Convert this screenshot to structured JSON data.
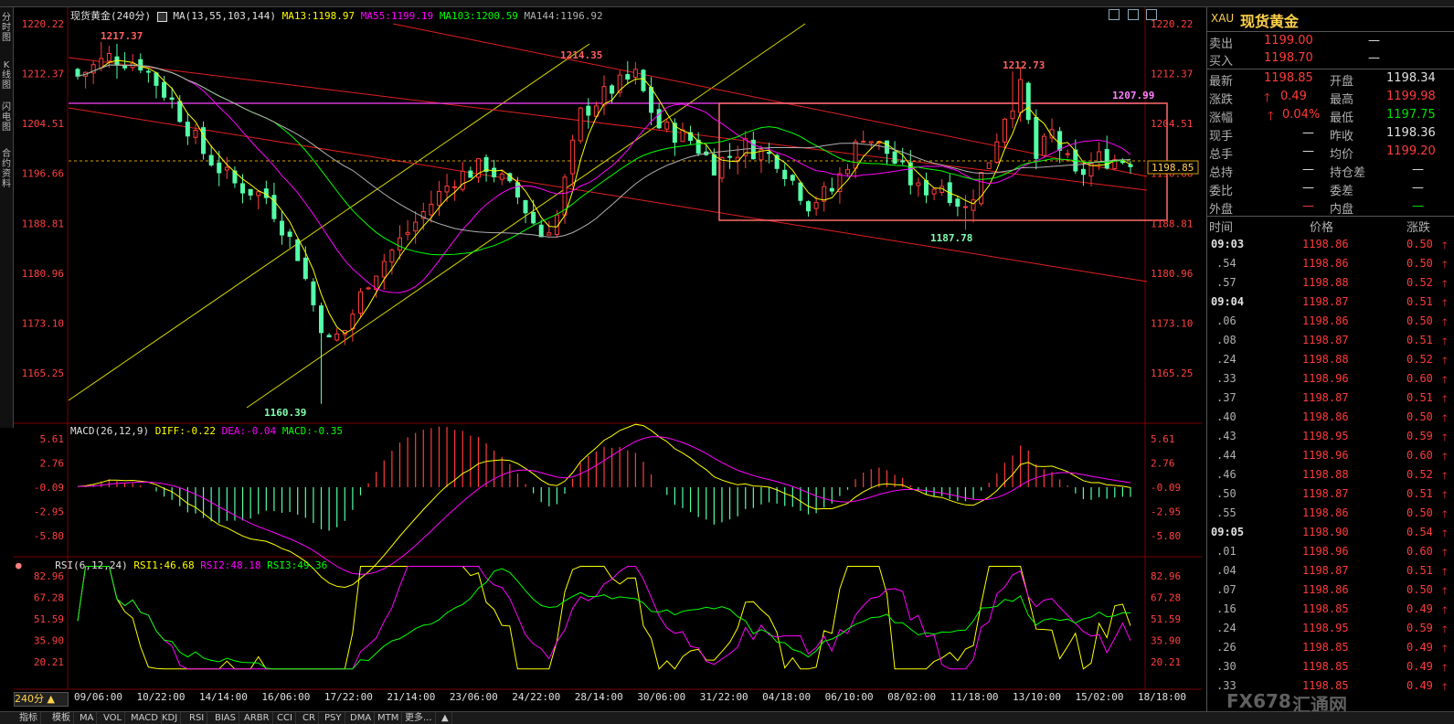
{
  "left_tabs": [
    "分时图",
    "K线图",
    "闪电图",
    "合约资料"
  ],
  "header": {
    "instrument": "现货黄金",
    "period": "240分",
    "ma_label": "MA(13,55,103,144)",
    "ma13": "MA13:1198.97",
    "ma55": "MA55:1199.19",
    "ma103": "MA103:1200.59",
    "ma144": "MA144:1196.92"
  },
  "price_axis": [
    "1220.22",
    "1212.37",
    "1204.51",
    "1196.66",
    "1188.81",
    "1180.96",
    "1173.10",
    "1165.25"
  ],
  "annotations": {
    "high1": "1217.37",
    "high2": "1214.35",
    "high3": "1212.73",
    "hline": "1207.99",
    "low1": "1160.39",
    "low2": "1187.78",
    "current": "1198.85"
  },
  "macd": {
    "label": "MACD(26,12,9)",
    "diff": "DIFF:-0.22",
    "dea": "DEA:-0.04",
    "macd": "MACD:-0.35",
    "axis": [
      "5.61",
      "2.76",
      "-0.09",
      "-2.95",
      "-5.80"
    ]
  },
  "rsi": {
    "label": "RSI(6,12,24)",
    "rsi1": "RSI1:46.68",
    "rsi2": "RSI2:48.18",
    "rsi3": "RSI3:49.36",
    "axis": [
      "82.96",
      "67.28",
      "51.59",
      "35.90",
      "20.21"
    ]
  },
  "time_axis": [
    "09/06:00",
    "10/22:00",
    "14/14:00",
    "16/06:00",
    "17/22:00",
    "21/14:00",
    "23/06:00",
    "24/22:00",
    "28/14:00",
    "30/06:00",
    "31/22:00",
    "04/18:00",
    "06/10:00",
    "08/02:00",
    "11/18:00",
    "13/10:00",
    "15/02:00",
    "18/18:00"
  ],
  "period_selector": "240分",
  "bottom_tabs": [
    "指标",
    "模板",
    "MA",
    "VOL",
    "MACD",
    "KDJ",
    "RSI",
    "BIAS",
    "ARBR",
    "CCI",
    "CR",
    "PSY",
    "DMA",
    "MTM",
    "更多..."
  ],
  "quote": {
    "code": "XAU",
    "name": "现货黄金",
    "sell_label": "卖出",
    "sell": "1199.00",
    "sell_vol": "—",
    "buy_label": "买入",
    "buy": "1198.70",
    "buy_vol": "—",
    "last_label": "最新",
    "last": "1198.85",
    "open_label": "开盘",
    "open": "1198.34",
    "chg_label": "涨跌",
    "chg": "0.49",
    "high_label": "最高",
    "high": "1199.98",
    "pct_label": "涨幅",
    "pct": "0.04%",
    "low_label": "最低",
    "low": "1197.75",
    "now_label": "现手",
    "now": "—",
    "prev_label": "昨收",
    "prev": "1198.36",
    "total_label": "总手",
    "total": "—",
    "avg_label": "均价",
    "avg": "1199.20",
    "hold_label": "总持",
    "hold": "—",
    "holdchg_label": "持仓差",
    "holdchg": "—",
    "ratio_label": "委比",
    "ratio": "—",
    "diff_label": "委差",
    "diff": "—",
    "outer_label": "外盘",
    "outer": "—",
    "inner_label": "内盘",
    "inner": "—"
  },
  "ticks_header": {
    "time": "时间",
    "price": "价格",
    "change": "涨跌"
  },
  "ticks": [
    {
      "t": "09:03",
      "p": "1198.86",
      "c": "0.50"
    },
    {
      "t": ".54",
      "p": "1198.86",
      "c": "0.50"
    },
    {
      "t": ".57",
      "p": "1198.88",
      "c": "0.52"
    },
    {
      "t": "09:04",
      "p": "1198.87",
      "c": "0.51"
    },
    {
      "t": ".06",
      "p": "1198.86",
      "c": "0.50"
    },
    {
      "t": ".08",
      "p": "1198.87",
      "c": "0.51"
    },
    {
      "t": ".24",
      "p": "1198.88",
      "c": "0.52"
    },
    {
      "t": ".33",
      "p": "1198.96",
      "c": "0.60"
    },
    {
      "t": ".37",
      "p": "1198.87",
      "c": "0.51"
    },
    {
      "t": ".40",
      "p": "1198.86",
      "c": "0.50"
    },
    {
      "t": ".43",
      "p": "1198.95",
      "c": "0.59"
    },
    {
      "t": ".44",
      "p": "1198.96",
      "c": "0.60"
    },
    {
      "t": ".46",
      "p": "1198.88",
      "c": "0.52"
    },
    {
      "t": ".50",
      "p": "1198.87",
      "c": "0.51"
    },
    {
      "t": ".55",
      "p": "1198.86",
      "c": "0.50"
    },
    {
      "t": "09:05",
      "p": "1198.90",
      "c": "0.54"
    },
    {
      "t": ".01",
      "p": "1198.96",
      "c": "0.60"
    },
    {
      "t": ".04",
      "p": "1198.87",
      "c": "0.51"
    },
    {
      "t": ".07",
      "p": "1198.86",
      "c": "0.50"
    },
    {
      "t": ".16",
      "p": "1198.85",
      "c": "0.49"
    },
    {
      "t": ".24",
      "p": "1198.95",
      "c": "0.59"
    },
    {
      "t": ".26",
      "p": "1198.85",
      "c": "0.49"
    },
    {
      "t": ".30",
      "p": "1198.85",
      "c": "0.49"
    },
    {
      "t": ".33",
      "p": "1198.85",
      "c": "0.49"
    }
  ],
  "watermark": {
    "latin": "FX678",
    "cn": "汇通网"
  },
  "colors": {
    "up": "#ff3b3b",
    "down": "#54ffa8",
    "ma13": "#ffff00",
    "ma55": "#ff00ff",
    "ma103": "#00ff00",
    "ma144": "#b0b0b0"
  }
}
